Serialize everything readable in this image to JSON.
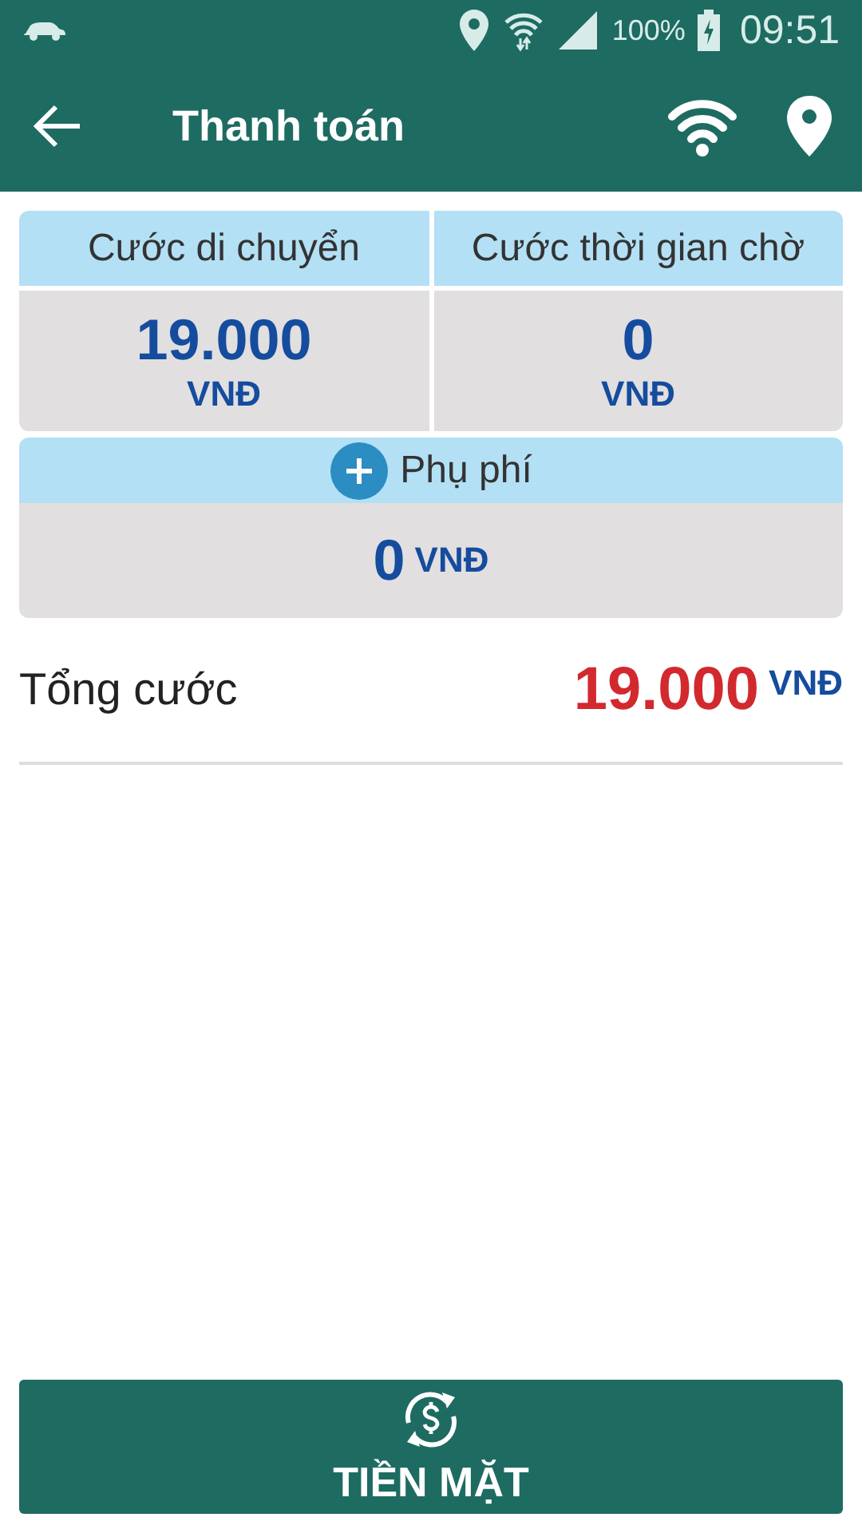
{
  "status_bar": {
    "battery": "100%",
    "time": "09:51"
  },
  "app_bar": {
    "title": "Thanh toán"
  },
  "fares": [
    {
      "label": "Cước di chuyển",
      "amount": "19.000",
      "currency": "VNĐ"
    },
    {
      "label": "Cước thời gian chờ",
      "amount": "0",
      "currency": "VNĐ"
    }
  ],
  "surcharge": {
    "label": "Phụ phí",
    "amount": "0",
    "currency": "VNĐ"
  },
  "total": {
    "label": "Tổng cước",
    "amount": "19.000",
    "currency": "VNĐ"
  },
  "pay_button": {
    "label": "TIỀN MẶT"
  }
}
